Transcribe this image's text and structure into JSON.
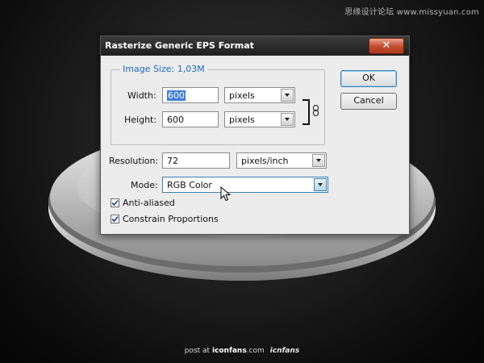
{
  "watermark": "思缘设计论坛 www.missyuan.com",
  "credit": {
    "prefix": "post at",
    "site": "iconfans",
    "domain": ".com",
    "logo": "icnfans"
  },
  "dialog": {
    "title": "Rasterize Generic EPS Format",
    "close_label": "✕",
    "image_size": "Image Size: 1,03M",
    "width_label": "Width:",
    "width_value": "600",
    "width_unit": "pixels",
    "height_label": "Height:",
    "height_value": "600",
    "height_unit": "pixels",
    "resolution_label": "Resolution:",
    "resolution_value": "72",
    "resolution_unit": "pixels/inch",
    "mode_label": "Mode:",
    "mode_value": "RGB Color",
    "anti_aliased_label": "Anti-aliased",
    "anti_aliased_checked": true,
    "constrain_label": "Constrain Proportions",
    "constrain_checked": true,
    "ok_label": "OK",
    "cancel_label": "Cancel"
  },
  "colors": {
    "accent": "#1e6cc4",
    "selection": "#3f7fd6",
    "close": "#c34a2c"
  }
}
